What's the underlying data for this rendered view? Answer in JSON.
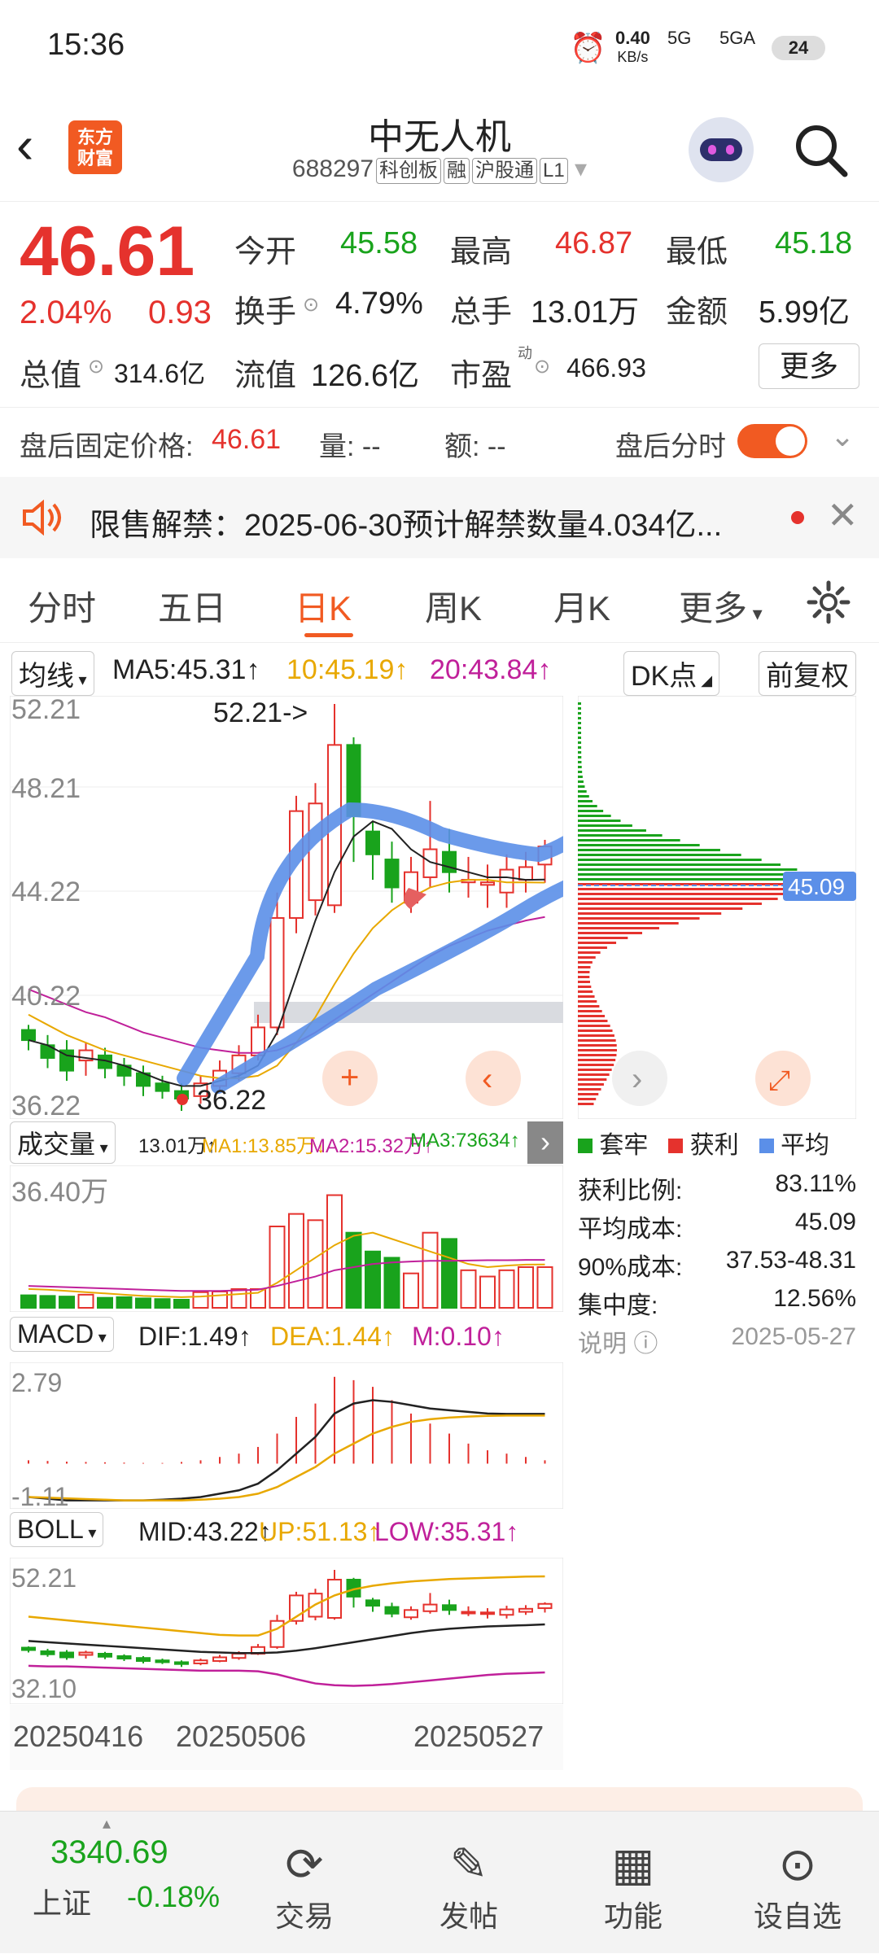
{
  "status": {
    "time": "15:36",
    "net_speed": "0.40",
    "net_unit": "KB/s",
    "sig1": "5G",
    "sig2": "5GA",
    "battery": "24"
  },
  "header": {
    "title": "中无人机",
    "code": "688297",
    "tags": [
      "科创板",
      "融",
      "沪股通",
      "L1"
    ],
    "logo_line1": "东方",
    "logo_line2": "财富"
  },
  "quote": {
    "price": "46.61",
    "change_pct": "2.04%",
    "change": "0.93",
    "open_label": "今开",
    "open": "45.58",
    "high_label": "最高",
    "high": "46.87",
    "low_label": "最低",
    "low": "45.18",
    "turnover_label": "换手",
    "turnover": "4.79%",
    "volume_label": "总手",
    "volume": "13.01万",
    "amount_label": "金额",
    "amount": "5.99亿",
    "mktcap_label": "总值",
    "mktcap": "314.6亿",
    "float_label": "流值",
    "float": "126.6亿",
    "pe_label": "市盈",
    "pe_sup": "动",
    "pe": "466.93",
    "more": "更多"
  },
  "after_hours": {
    "label": "盘后固定价格:",
    "price": "46.61",
    "vol_label": "量: --",
    "amt_label": "额: --",
    "toggle_label": "盘后分时"
  },
  "notice": {
    "text": "限售解禁：2025-06-30预计解禁数量4.034亿..."
  },
  "tabs": [
    "分时",
    "五日",
    "日K",
    "周K",
    "月K",
    "更多"
  ],
  "active_tab": "日K",
  "ma": {
    "label": "均线",
    "ma5": "MA5:45.31↑",
    "ma10": "10:45.19↑",
    "ma20": "20:43.84↑",
    "dk": "DK点",
    "adj": "前复权"
  },
  "axis": {
    "p1": "52.21",
    "p2": "48.21",
    "p3": "44.22",
    "p4": "40.22",
    "p5": "36.22",
    "high_mark": "52.21->",
    "low_mark": "36.22",
    "chip_avg": "45.09"
  },
  "legend": {
    "l1": "套牢",
    "l2": "获利",
    "l3": "平均"
  },
  "chip_stats": [
    {
      "k": "获利比例:",
      "v": "83.11%"
    },
    {
      "k": "平均成本:",
      "v": "45.09"
    },
    {
      "k": "90%成本:",
      "v": "37.53-48.31"
    },
    {
      "k": "集中度:",
      "v": "12.56%"
    }
  ],
  "chip_note": {
    "label": "说明",
    "date": "2025-05-27"
  },
  "volume": {
    "label": "成交量",
    "v": "13.01万↑",
    "ma1": "MA1:13.85万↓",
    "ma2": "MA2:15.32万↑",
    "ma3": "MA3:73634↑",
    "axis": "36.40万"
  },
  "macd": {
    "label": "MACD",
    "dif": "DIF:1.49↑",
    "dea": "DEA:1.44↑",
    "m": "M:0.10↑",
    "top": "2.79",
    "bottom": "-1.11"
  },
  "boll": {
    "label": "BOLL",
    "mid": "MID:43.22↑",
    "up": "UP:51.13↑",
    "low": "LOW:35.31↑",
    "top": "52.21",
    "bottom": "32.10"
  },
  "dates": [
    "20250416",
    "20250506",
    "20250527"
  ],
  "bottom": {
    "index_value": "3340.69",
    "index_name": "上证",
    "index_change": "-0.18%",
    "nav": [
      "交易",
      "发帖",
      "功能",
      "设自选"
    ]
  },
  "colors": {
    "up": "#e5322d",
    "down": "#19a31c",
    "accent": "#f15a22",
    "annotation": "#5b8fe8"
  }
}
